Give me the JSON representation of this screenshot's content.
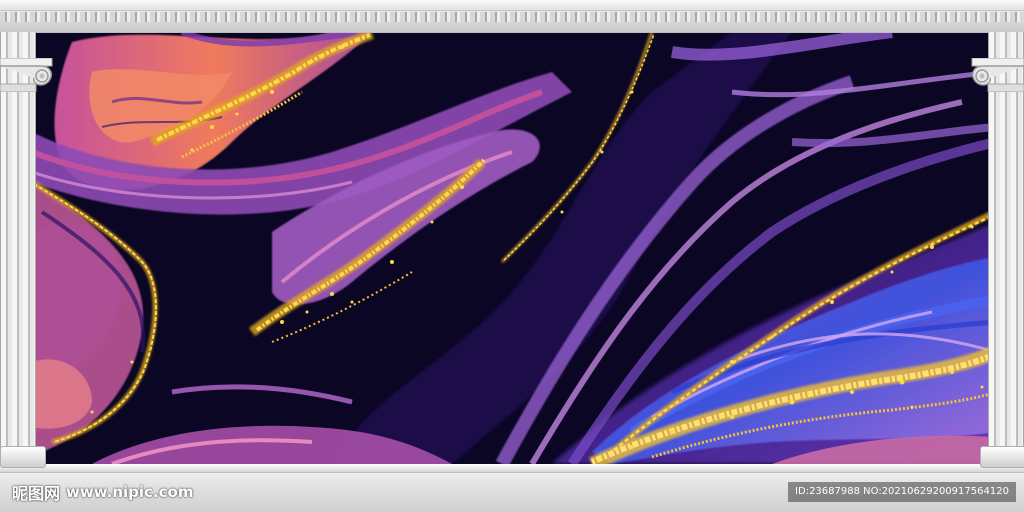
{
  "image": {
    "subject": "purple-and-gold-marble-mural-framed-by-classical-columns",
    "palette": {
      "deep_navy": "#0a0624",
      "violet": "#5b2fb8",
      "lavender": "#a970d8",
      "magenta": "#c6529b",
      "coral": "#f07a5c",
      "gold": "#f2c232",
      "blue": "#3f55e0",
      "frame_white": "#ececec"
    }
  },
  "watermark": {
    "site_name": "昵图网",
    "url": "www.nipic.com",
    "id_text": "ID:23687988 NO:20210629200917564120"
  }
}
